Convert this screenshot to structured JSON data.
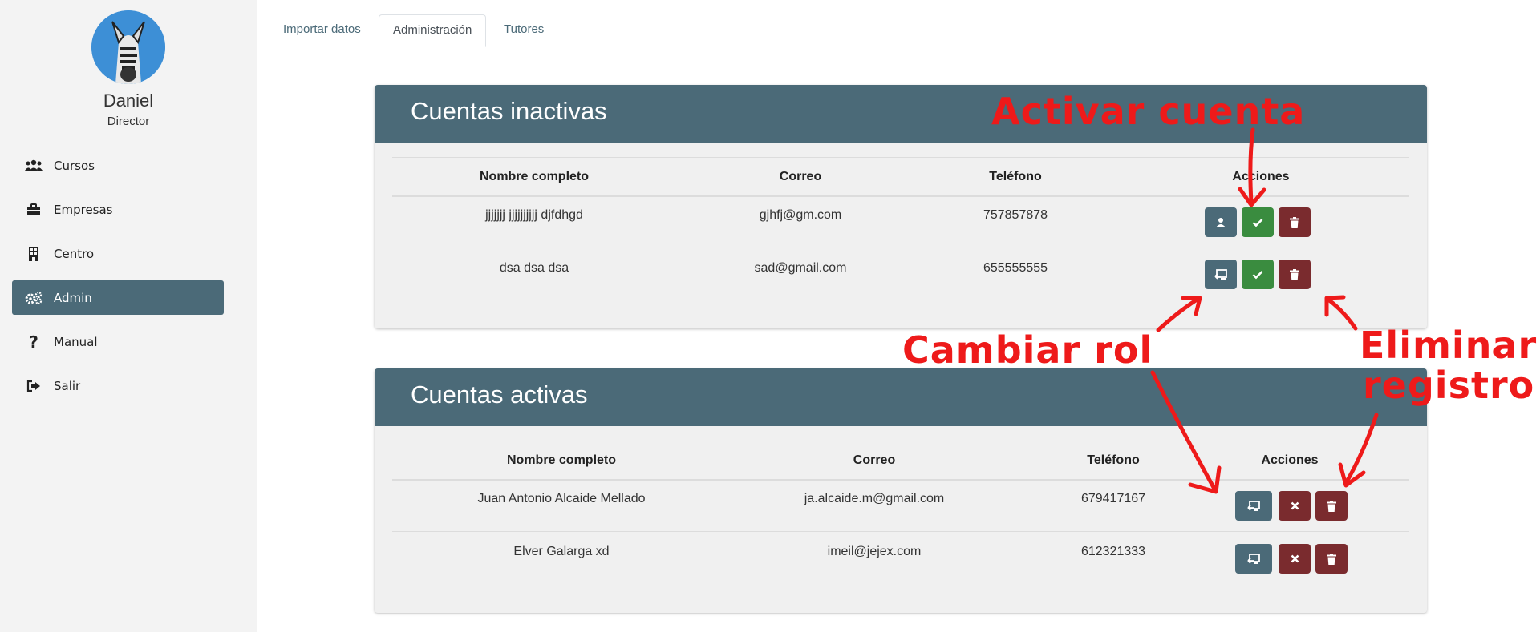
{
  "user": {
    "name": "Daniel",
    "role": "Director"
  },
  "nav": [
    {
      "label": "Cursos",
      "icon": "users-icon",
      "active": false
    },
    {
      "label": "Empresas",
      "icon": "briefcase-icon",
      "active": false
    },
    {
      "label": "Centro",
      "icon": "building-icon",
      "active": false
    },
    {
      "label": "Admin",
      "icon": "gears-icon",
      "active": true
    },
    {
      "label": "Manual",
      "icon": "question-icon",
      "active": false
    },
    {
      "label": "Salir",
      "icon": "sign-out-icon",
      "active": false
    }
  ],
  "tabs": [
    {
      "label": "Importar datos",
      "active": false
    },
    {
      "label": "Administración",
      "active": true
    },
    {
      "label": "Tutores",
      "active": false
    }
  ],
  "inactive": {
    "title": "Cuentas inactivas",
    "columns": [
      "Nombre completo",
      "Correo",
      "Teléfono",
      "Acciones"
    ],
    "rows": [
      {
        "name": "jjjjjjj jjjjjjjjjj djfdhgd",
        "email": "gjhfj@gm.com",
        "phone": "757857878",
        "actions": [
          "user-icon",
          "check-icon",
          "trash-icon"
        ]
      },
      {
        "name": "dsa dsa dsa",
        "email": "sad@gmail.com",
        "phone": "655555555",
        "actions": [
          "swap-role-icon",
          "check-icon",
          "trash-icon"
        ]
      }
    ]
  },
  "active": {
    "title": "Cuentas activas",
    "columns": [
      "Nombre completo",
      "Correo",
      "Teléfono",
      "Acciones"
    ],
    "rows": [
      {
        "name": "Juan Antonio Alcaide Mellado",
        "email": "ja.alcaide.m@gmail.com",
        "phone": "679417167",
        "actions": [
          "swap-role-icon",
          "times-icon",
          "trash-icon"
        ]
      },
      {
        "name": "Elver Galarga xd",
        "email": "imeil@jejex.com",
        "phone": "612321333",
        "actions": [
          "swap-role-icon",
          "times-icon",
          "trash-icon"
        ]
      }
    ]
  },
  "annotations": {
    "activate": "Activar cuenta",
    "change_role": "Cambiar rol",
    "delete_line1": "Eliminar",
    "delete_line2": "registro"
  },
  "colors": {
    "primary": "#4b6a78",
    "success": "#3a8c3f",
    "danger": "#7a2b2e",
    "annotation": "#ee1a1a"
  }
}
